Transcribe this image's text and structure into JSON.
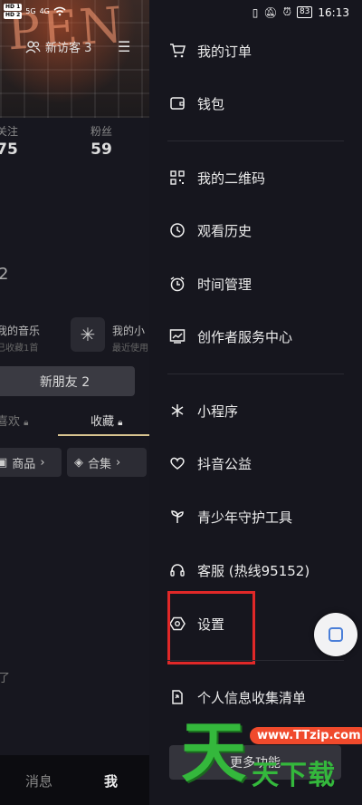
{
  "status_bar": {
    "sim1": "HD 1",
    "sim2": "HD 2",
    "signal1": "5G",
    "signal2": "4G",
    "battery": "83",
    "time": "16:13"
  },
  "profile": {
    "banner_text": "PEN",
    "visitors_label": "新访客 3",
    "following_label": "关注",
    "following_count": "75",
    "fans_label": "粉丝",
    "fans_count": "59",
    "stray_number": "2",
    "music_title": "我的音乐",
    "music_sub": "已收藏1首",
    "mini_title": "我的小",
    "mini_sub": "最近使用",
    "new_friends": "新朋友 2",
    "tab_like": "喜欢",
    "tab_fav": "收藏",
    "chip_goods": "商品",
    "chip_collection": "合集",
    "empty_text": "了",
    "nav_messages": "消息",
    "nav_me": "我"
  },
  "drawer": {
    "items": [
      {
        "label": "我的订单",
        "icon": "cart-icon"
      },
      {
        "label": "钱包",
        "icon": "wallet-icon"
      },
      {
        "label": "我的二维码",
        "icon": "qrcode-icon"
      },
      {
        "label": "观看历史",
        "icon": "clock-icon"
      },
      {
        "label": "时间管理",
        "icon": "alarm-icon"
      },
      {
        "label": "创作者服务中心",
        "icon": "chart-icon"
      },
      {
        "label": "小程序",
        "icon": "asterisk-icon"
      },
      {
        "label": "抖音公益",
        "icon": "heart-icon"
      },
      {
        "label": "青少年守护工具",
        "icon": "sprout-icon"
      },
      {
        "label": "客服 (热线95152)",
        "icon": "headset-icon"
      },
      {
        "label": "设置",
        "icon": "hexagon-settings-icon"
      },
      {
        "label": "个人信息收集清单",
        "icon": "doc-share-icon"
      }
    ],
    "more_button": "更多功能"
  },
  "watermark": {
    "big_char": "天",
    "url": "www.TTzip.com",
    "small_text": "天下载"
  },
  "colors": {
    "highlight_box": "#e02828",
    "tab_underline": "#d8c490",
    "watermark_green": "#34b83c",
    "watermark_red": "#f04a2c"
  }
}
